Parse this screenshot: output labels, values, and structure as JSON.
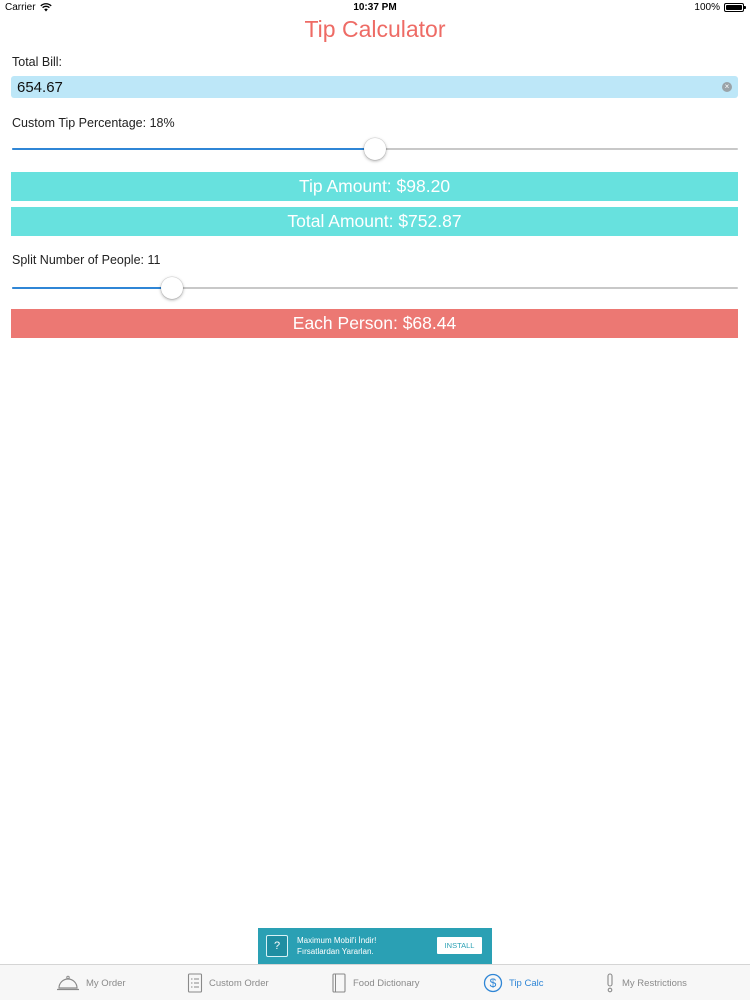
{
  "status_bar": {
    "carrier": "Carrier",
    "time": "10:37 PM",
    "battery": "100%"
  },
  "title": "Tip Calculator",
  "bill": {
    "label": "Total Bill:",
    "value": "654.67"
  },
  "tip": {
    "label": "Custom Tip Percentage: 18%",
    "slider_value": 0.5
  },
  "results": {
    "tip_amount": "Tip Amount: $98.20",
    "total_amount": "Total Amount: $752.87"
  },
  "split": {
    "label": "Split Number of People: 11",
    "slider_value": 0.22
  },
  "each_person": "Each Person: $68.44",
  "ad": {
    "line1": "Maximum Mobil'i İndir!",
    "line2": "Fırsatlardan Yararlan.",
    "install": "INSTALL"
  },
  "tabs": [
    {
      "label": "My Order",
      "icon": "cloche-icon"
    },
    {
      "label": "Custom Order",
      "icon": "list-icon"
    },
    {
      "label": "Food Dictionary",
      "icon": "book-icon"
    },
    {
      "label": "Tip Calc",
      "icon": "dollar-icon",
      "active": true
    },
    {
      "label": "My Restrictions",
      "icon": "exclamation-icon"
    }
  ],
  "colors": {
    "title": "#ee6b65",
    "input_bg": "#bde7f8",
    "teal_bar": "#67e1de",
    "red_bar": "#ec7873",
    "active_tab": "#2f86d6",
    "ad_bg": "#2aa0b4"
  }
}
